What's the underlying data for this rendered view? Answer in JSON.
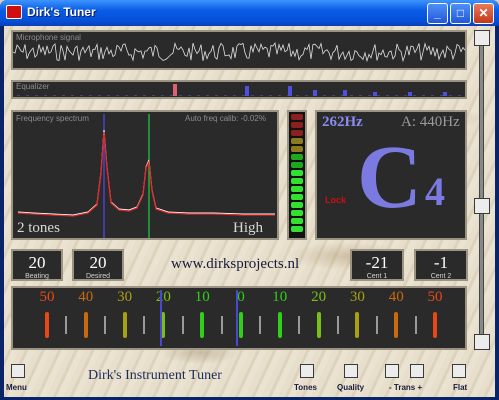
{
  "window": {
    "title": "Dirk's Tuner"
  },
  "mic": {
    "label": "Microphone signal"
  },
  "eq": {
    "label": "Equalizer"
  },
  "spectrum": {
    "label": "Frequency spectrum",
    "calib": "Auto freq calib: -0.02%",
    "tones": "2 tones",
    "range": "High"
  },
  "note": {
    "freq": "262Hz",
    "ref": "A: 440Hz",
    "name": "C",
    "octave": "4",
    "lock": "Lock"
  },
  "boxes": {
    "beating": {
      "value": "20",
      "caption": "Beating"
    },
    "desired": {
      "value": "20",
      "caption": "Desired"
    },
    "cent1": {
      "value": "-21",
      "caption": "Cent 1"
    },
    "cent2": {
      "value": "-1",
      "caption": "Cent 2"
    }
  },
  "url": "www.dirksprojects.nl",
  "app_name": "Dirk's Instrument Tuner",
  "ruler": {
    "labels": [
      "50",
      "40",
      "30",
      "20",
      "10",
      "0",
      "10",
      "20",
      "30",
      "40",
      "50"
    ],
    "colors": [
      "#e84818",
      "#c86a10",
      "#a8a010",
      "#78c018",
      "#30d018",
      "#30d018",
      "#30d018",
      "#78c018",
      "#a8a010",
      "#c86a10",
      "#e84818"
    ]
  },
  "buttons": {
    "menu": "Menu",
    "tones": "Tones",
    "quality": "Quality",
    "trans_minus": "- Trans +",
    "flat": "Flat"
  },
  "colors": {
    "panel_bg": "#2a2a2a",
    "note_color": "#7a7ae0",
    "peak_color": "#e02828",
    "lock_color": "#cc1010"
  }
}
